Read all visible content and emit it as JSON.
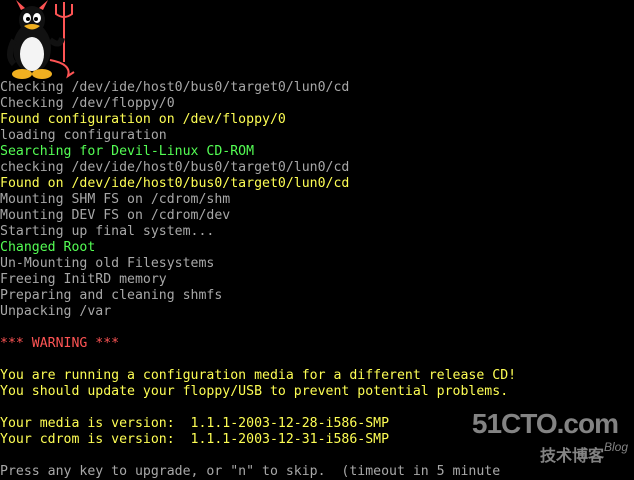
{
  "console": {
    "lines": [
      {
        "text": "Checking /dev/ide/host0/bus0/target0/lun0/cd",
        "color": "white"
      },
      {
        "text": "Checking /dev/floppy/0",
        "color": "white"
      },
      {
        "text": "Found configuration on /dev/floppy/0",
        "color": "yellow"
      },
      {
        "text": "loading configuration",
        "color": "white"
      },
      {
        "text": "Searching for Devil-Linux CD-ROM",
        "color": "green"
      },
      {
        "text": "checking /dev/ide/host0/bus0/target0/lun0/cd",
        "color": "white"
      },
      {
        "text": "Found on /dev/ide/host0/bus0/target0/lun0/cd",
        "color": "yellow"
      },
      {
        "text": "Mounting SHM FS on /cdrom/shm",
        "color": "white"
      },
      {
        "text": "Mounting DEV FS on /cdrom/dev",
        "color": "white"
      },
      {
        "text": "Starting up final system...",
        "color": "white"
      },
      {
        "text": "Changed Root",
        "color": "green"
      },
      {
        "text": "Un-Mounting old Filesystems",
        "color": "white"
      },
      {
        "text": "Freeing InitRD memory",
        "color": "white"
      },
      {
        "text": "Preparing and cleaning shmfs",
        "color": "white"
      },
      {
        "text": "Unpacking /var",
        "color": "white"
      },
      {
        "text": "",
        "color": "blank"
      },
      {
        "text": "*** WARNING ***",
        "color": "red"
      },
      {
        "text": "",
        "color": "blank"
      },
      {
        "text": "You are running a configuration media for a different release CD!",
        "color": "yellow"
      },
      {
        "text": "You should update your floppy/USB to prevent potential problems.",
        "color": "yellow"
      },
      {
        "text": "",
        "color": "blank"
      },
      {
        "text": "Your media is version:  1.1.1-2003-12-28-i586-SMP",
        "color": "yellow"
      },
      {
        "text": "Your cdrom is version:  1.1.1-2003-12-31-i586-SMP",
        "color": "yellow"
      },
      {
        "text": "",
        "color": "blank"
      },
      {
        "text": "Press any key to upgrade, or \"n\" to skip.  (timeout in 5 minute",
        "color": "white"
      }
    ]
  },
  "logo": {
    "icon": "devil-tux-icon"
  },
  "watermark": {
    "brand": "51CTO.com",
    "subtitle": "技术博客",
    "blog": "Blog"
  },
  "colors": {
    "background": "#000000",
    "white": "#a8a8a8",
    "yellow": "#fefe54",
    "green": "#54fe54",
    "red": "#fe5454"
  }
}
